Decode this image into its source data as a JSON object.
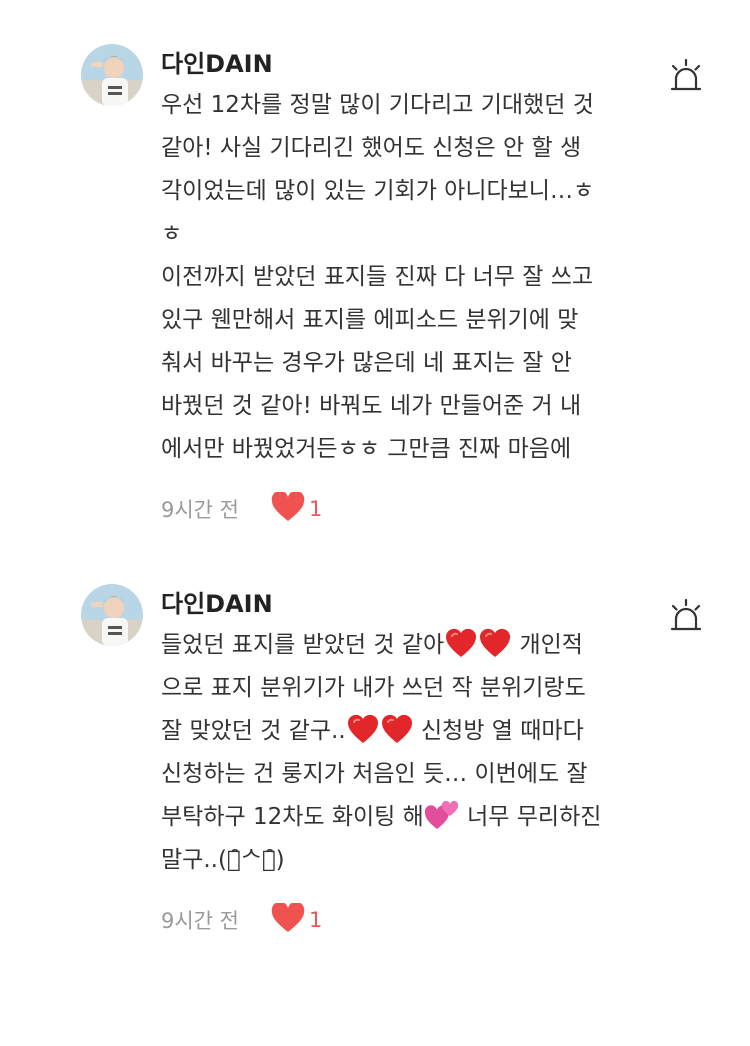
{
  "comments": [
    {
      "author": "다인DAIN",
      "lines": [
        [
          {
            "t": "우선 12차를 정말 많이 기다리고 기대했던 것"
          }
        ],
        [
          {
            "t": "같아! 사실 기다리긴 했어도 신청은 안 할 생"
          }
        ],
        [
          {
            "t": "각이었는데 많이 있는 기회가 아니다보니…ㅎ"
          }
        ],
        [
          {
            "t": "ㅎ"
          }
        ],
        [
          {
            "t": "이전까지 받았던 표지들 진짜 다 너무 잘 쓰고"
          }
        ],
        [
          {
            "t": "있구 웬만해서 표지를 에피소드 분위기에 맞"
          }
        ],
        [
          {
            "t": "춰서 바꾸는 경우가 많은데 네 표지는 잘 안"
          }
        ],
        [
          {
            "t": "바꿨던 것 같아! 바꿔도 네가 만들어준 거 내"
          }
        ],
        [
          {
            "t": "에서만 바꿨었거든ㅎㅎ 그만큼 진짜 마음에"
          }
        ]
      ],
      "time": "9시간 전",
      "likes": "1"
    },
    {
      "author": "다인DAIN",
      "lines": [
        [
          {
            "t": "들었던 표지를 받았던 것 같아"
          },
          {
            "emoji": "red-heart"
          },
          {
            "emoji": "red-heart"
          },
          {
            "t": " 개인적"
          }
        ],
        [
          {
            "t": "으로 표지 분위기가 내가 쓰던 작 분위기랑도"
          }
        ],
        [
          {
            "t": "잘 맞았던 것 같구.."
          },
          {
            "emoji": "red-heart"
          },
          {
            "emoji": "red-heart"
          },
          {
            "t": " 신청방 열 때마다"
          }
        ],
        [
          {
            "t": "신청하는 건 룽지가 처음인 듯… 이번에도 잘"
          }
        ],
        [
          {
            "t": "부탁하구 12차도 화이팅 해"
          },
          {
            "emoji": "two-hearts"
          },
          {
            "t": " 너무 무리하진"
          }
        ],
        [
          {
            "t": "말구..(ꈍ̑ᄉꈍ̑)"
          }
        ]
      ],
      "time": "9시간 전",
      "likes": "1"
    }
  ],
  "icons": {
    "report": "siren-icon",
    "like": "heart-icon",
    "avatar": "profile-avatar"
  },
  "colors": {
    "like": "#f0524f",
    "like_count": "#e75a55",
    "time": "#9a9a9a",
    "text": "#333333"
  }
}
